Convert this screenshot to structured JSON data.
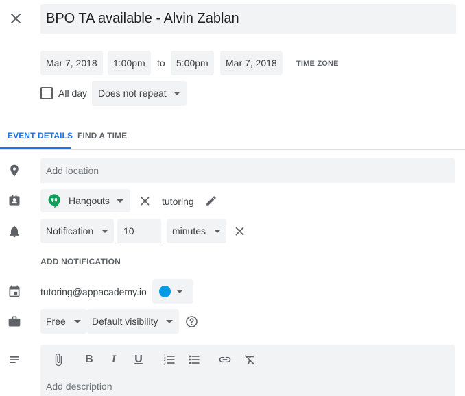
{
  "title": "BPO TA available - Alvin Zablan",
  "dates": {
    "start_date": "Mar 7, 2018",
    "start_time": "1:00pm",
    "to_label": "to",
    "end_time": "5:00pm",
    "end_date": "Mar 7, 2018",
    "time_zone_label": "TIME ZONE"
  },
  "all_day": {
    "label": "All day",
    "checked": false
  },
  "repeat": {
    "value": "Does not repeat"
  },
  "tabs": [
    {
      "label": "EVENT DETAILS",
      "active": true
    },
    {
      "label": "FIND A TIME",
      "active": false
    }
  ],
  "location": {
    "placeholder": "Add location"
  },
  "conferencing": {
    "type": "Hangouts",
    "name": "tutoring"
  },
  "notification": {
    "type": "Notification",
    "amount": "10",
    "unit": "minutes",
    "add_label": "ADD NOTIFICATION"
  },
  "calendar": {
    "name": "tutoring@appacademy.io",
    "color": "#039be5"
  },
  "availability": {
    "busy": "Free",
    "visibility": "Default visibility"
  },
  "description": {
    "placeholder": "Add description",
    "toolbar": [
      "attach-icon",
      "bold-icon",
      "italic-icon",
      "underline-icon",
      "numbered-list-icon",
      "bulleted-list-icon",
      "link-icon",
      "remove-formatting-icon"
    ]
  },
  "colors": {
    "accent": "#1a73e8",
    "field_bg": "#f1f3f4",
    "icon_gray": "#5f6368",
    "hangouts_green": "#0f9d58"
  }
}
